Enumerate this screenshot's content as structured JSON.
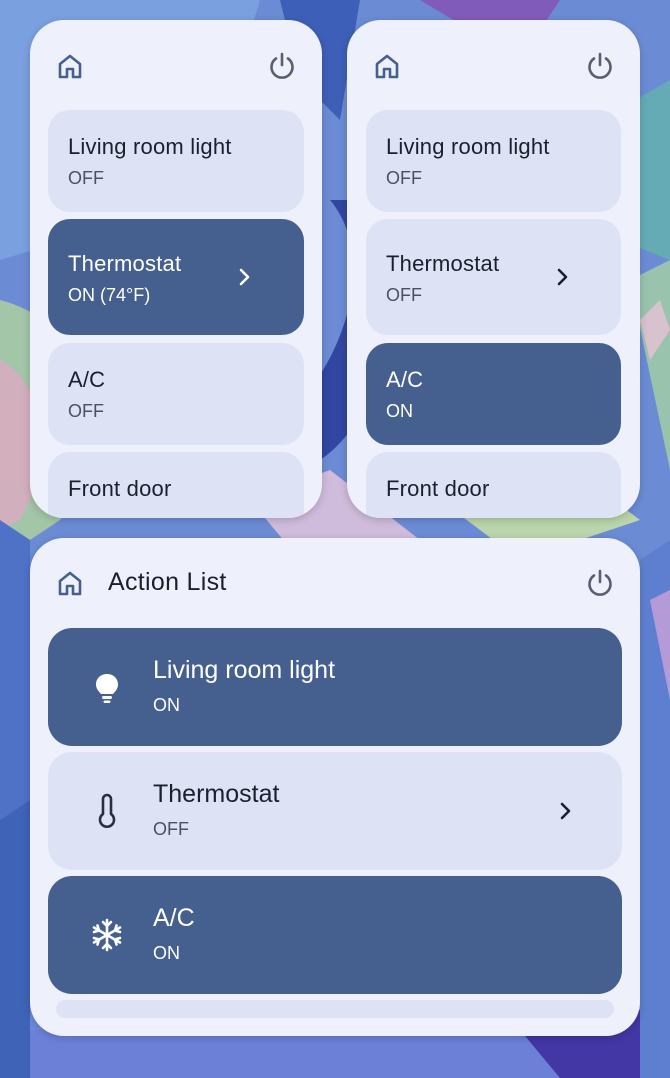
{
  "colors": {
    "widget_bg": "#eef0fb",
    "tile_off": "#dde3f5",
    "tile_on": "#455f8e",
    "icon": "#455f8e"
  },
  "widget_left": {
    "home_icon": "home-icon",
    "power_icon": "power-icon",
    "tiles": [
      {
        "title": "Living room light",
        "status": "OFF",
        "on": false
      },
      {
        "title": "Thermostat",
        "status": "ON (74°F)",
        "on": true,
        "chevron": true
      },
      {
        "title": "A/C",
        "status": "OFF",
        "on": false
      },
      {
        "title": "Front door",
        "status": "",
        "on": false
      }
    ]
  },
  "widget_right": {
    "home_icon": "home-icon",
    "power_icon": "power-icon",
    "tiles": [
      {
        "title": "Living room light",
        "status": "OFF",
        "on": false
      },
      {
        "title": "Thermostat",
        "status": "OFF",
        "on": false,
        "chevron": true
      },
      {
        "title": "A/C",
        "status": "ON",
        "on": true
      },
      {
        "title": "Front door",
        "status": "",
        "on": false
      }
    ]
  },
  "action_list": {
    "title": "Action List",
    "items": [
      {
        "title": "Living room light",
        "status": "ON",
        "on": true,
        "icon": "lightbulb-icon"
      },
      {
        "title": "Thermostat",
        "status": "OFF",
        "on": false,
        "icon": "thermometer-icon",
        "chevron": true
      },
      {
        "title": "A/C",
        "status": "ON",
        "on": true,
        "icon": "snowflake-icon"
      }
    ]
  }
}
